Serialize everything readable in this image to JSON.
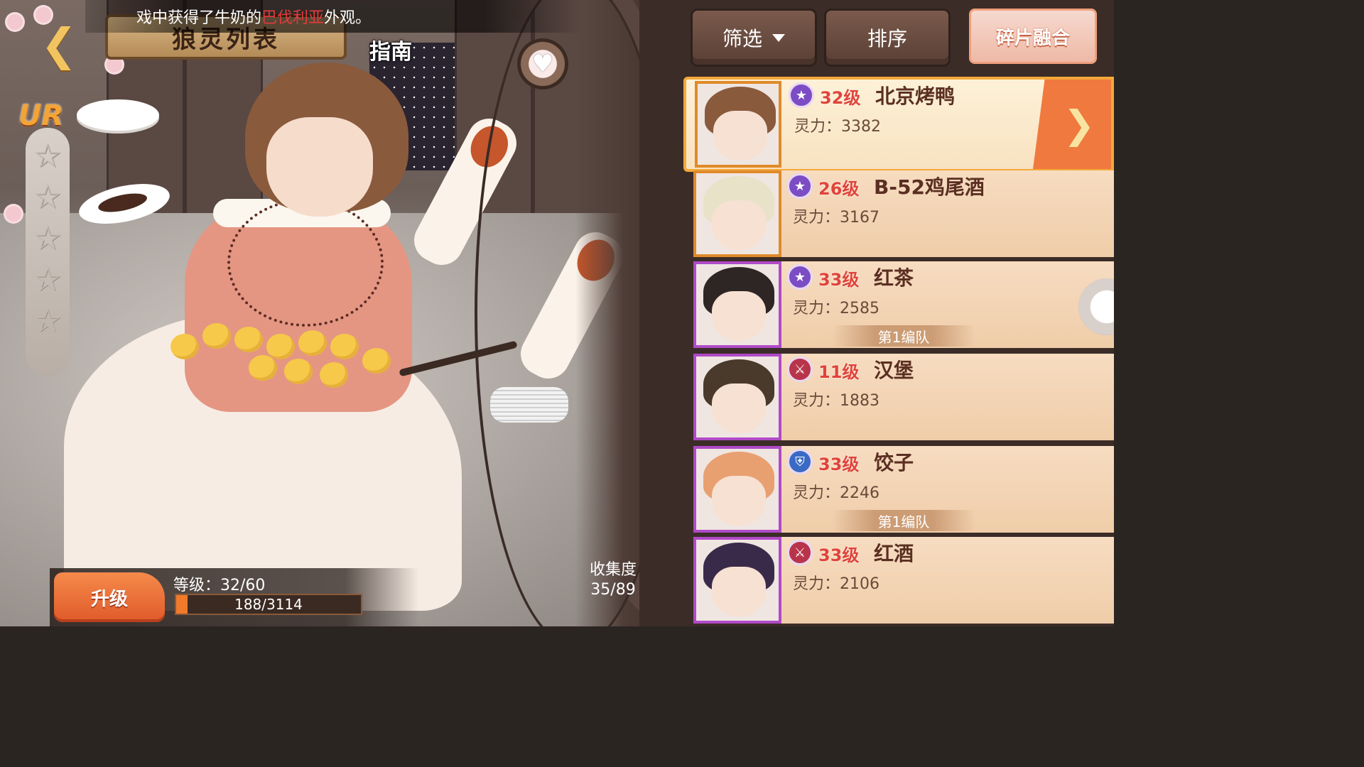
{
  "ticker": {
    "prefix": "戏中获得了牛奶的",
    "highlight": "巴伐利亚",
    "suffix": "外观。"
  },
  "title_plate": "狼灵列表",
  "guide_label": "指南",
  "rarity": "UR",
  "stars_total": 5,
  "stars_filled": 0,
  "level_panel": {
    "upgrade_label": "升级",
    "level_text": "等级：32/60",
    "exp_text": "188/3114",
    "exp_current": 188,
    "exp_max": 3114
  },
  "collection": {
    "label": "收集度",
    "value": "35/89"
  },
  "toolbar": {
    "filter_label": "筛选",
    "sort_label": "排序",
    "fuse_label": "碎片融合"
  },
  "characters": [
    {
      "level": "32级",
      "name": "北京烤鸭",
      "power": "灵力：3382",
      "team": "",
      "type": "star",
      "frame": "orange",
      "hair": "#8a5a3c",
      "selected": true
    },
    {
      "level": "26级",
      "name": "B-52鸡尾酒",
      "power": "灵力：3167",
      "team": "",
      "type": "star",
      "frame": "orange",
      "hair": "#e8e2c8",
      "selected": false
    },
    {
      "level": "33级",
      "name": "红茶",
      "power": "灵力：2585",
      "team": "第1编队",
      "type": "star",
      "frame": "purple",
      "hair": "#2e2624",
      "selected": false
    },
    {
      "level": "11级",
      "name": "汉堡",
      "power": "灵力：1883",
      "team": "",
      "type": "atk",
      "frame": "purple",
      "hair": "#4a3a2c",
      "selected": false
    },
    {
      "level": "33级",
      "name": "饺子",
      "power": "灵力：2246",
      "team": "第1编队",
      "type": "def",
      "frame": "purple",
      "hair": "#e8a070",
      "selected": false
    },
    {
      "level": "33级",
      "name": "红酒",
      "power": "灵力：2106",
      "team": "",
      "type": "atk",
      "frame": "purple",
      "hair": "#3a2a4a",
      "selected": false
    }
  ],
  "icons": {
    "back": "back-arrow-icon",
    "heart": "heart-icon",
    "filter_caret": "caret-down-icon",
    "next": "chevron-right-icon",
    "type_star": "star-badge-icon",
    "type_atk": "sword-badge-icon",
    "type_def": "shield-badge-icon"
  },
  "colors": {
    "accent_orange": "#f0793f",
    "level_red": "#e0443a",
    "ticker_highlight": "#e23b3b",
    "frame_purple": "#b04ac8",
    "frame_orange": "#e08a2a"
  }
}
